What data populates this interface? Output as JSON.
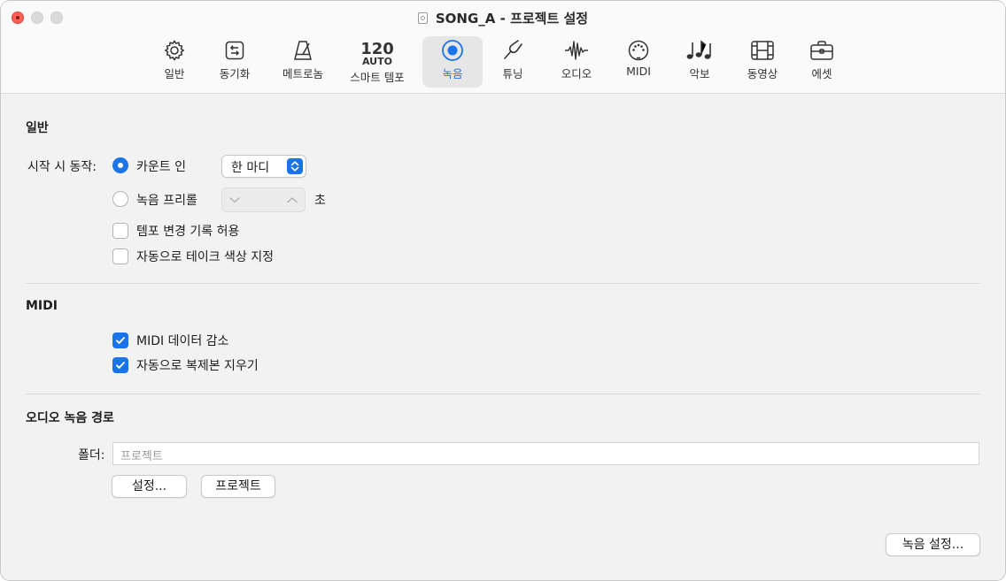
{
  "window": {
    "title": "SONG_A - 프로젝트 설정"
  },
  "colors": {
    "accent": "#1a73e8",
    "close": "#ff5f57"
  },
  "tabs": [
    {
      "label": "일반",
      "icon": "gear-icon"
    },
    {
      "label": "동기화",
      "icon": "sync-icon"
    },
    {
      "label": "메트로놈",
      "icon": "metronome-icon"
    },
    {
      "label": "스마트 템포",
      "icon": "smart-tempo-icon",
      "icon_text_top": "120",
      "icon_text_bottom": "AUTO"
    },
    {
      "label": "녹음",
      "icon": "record-icon",
      "active": true
    },
    {
      "label": "튜닝",
      "icon": "tuning-fork-icon"
    },
    {
      "label": "오디오",
      "icon": "waveform-icon"
    },
    {
      "label": "MIDI",
      "icon": "midi-port-icon"
    },
    {
      "label": "악보",
      "icon": "music-notes-icon"
    },
    {
      "label": "동영상",
      "icon": "film-icon"
    },
    {
      "label": "에셋",
      "icon": "briefcase-icon"
    }
  ],
  "general": {
    "title": "일반",
    "start_label": "시작 시 동작:",
    "count_in_label": "카운트 인",
    "count_in_checked": true,
    "count_in_value": "한 마디",
    "preroll_label": "녹음 프리롤",
    "preroll_checked": false,
    "preroll_unit": "초",
    "tempo_change_label": "템포 변경 기록 허용",
    "tempo_change_checked": false,
    "auto_color_label": "자동으로 테이크 색상 지정",
    "auto_color_checked": false
  },
  "midi": {
    "title": "MIDI",
    "reduce_label": "MIDI 데이터 감소",
    "reduce_checked": true,
    "remove_dup_label": "자동으로 복제본 지우기",
    "remove_dup_checked": true
  },
  "audio_path": {
    "title": "오디오 녹음 경로",
    "folder_label": "폴더:",
    "folder_placeholder": "프로젝트",
    "set_button": "설정...",
    "project_button": "프로젝트"
  },
  "footer": {
    "record_settings_button": "녹음 설정..."
  }
}
